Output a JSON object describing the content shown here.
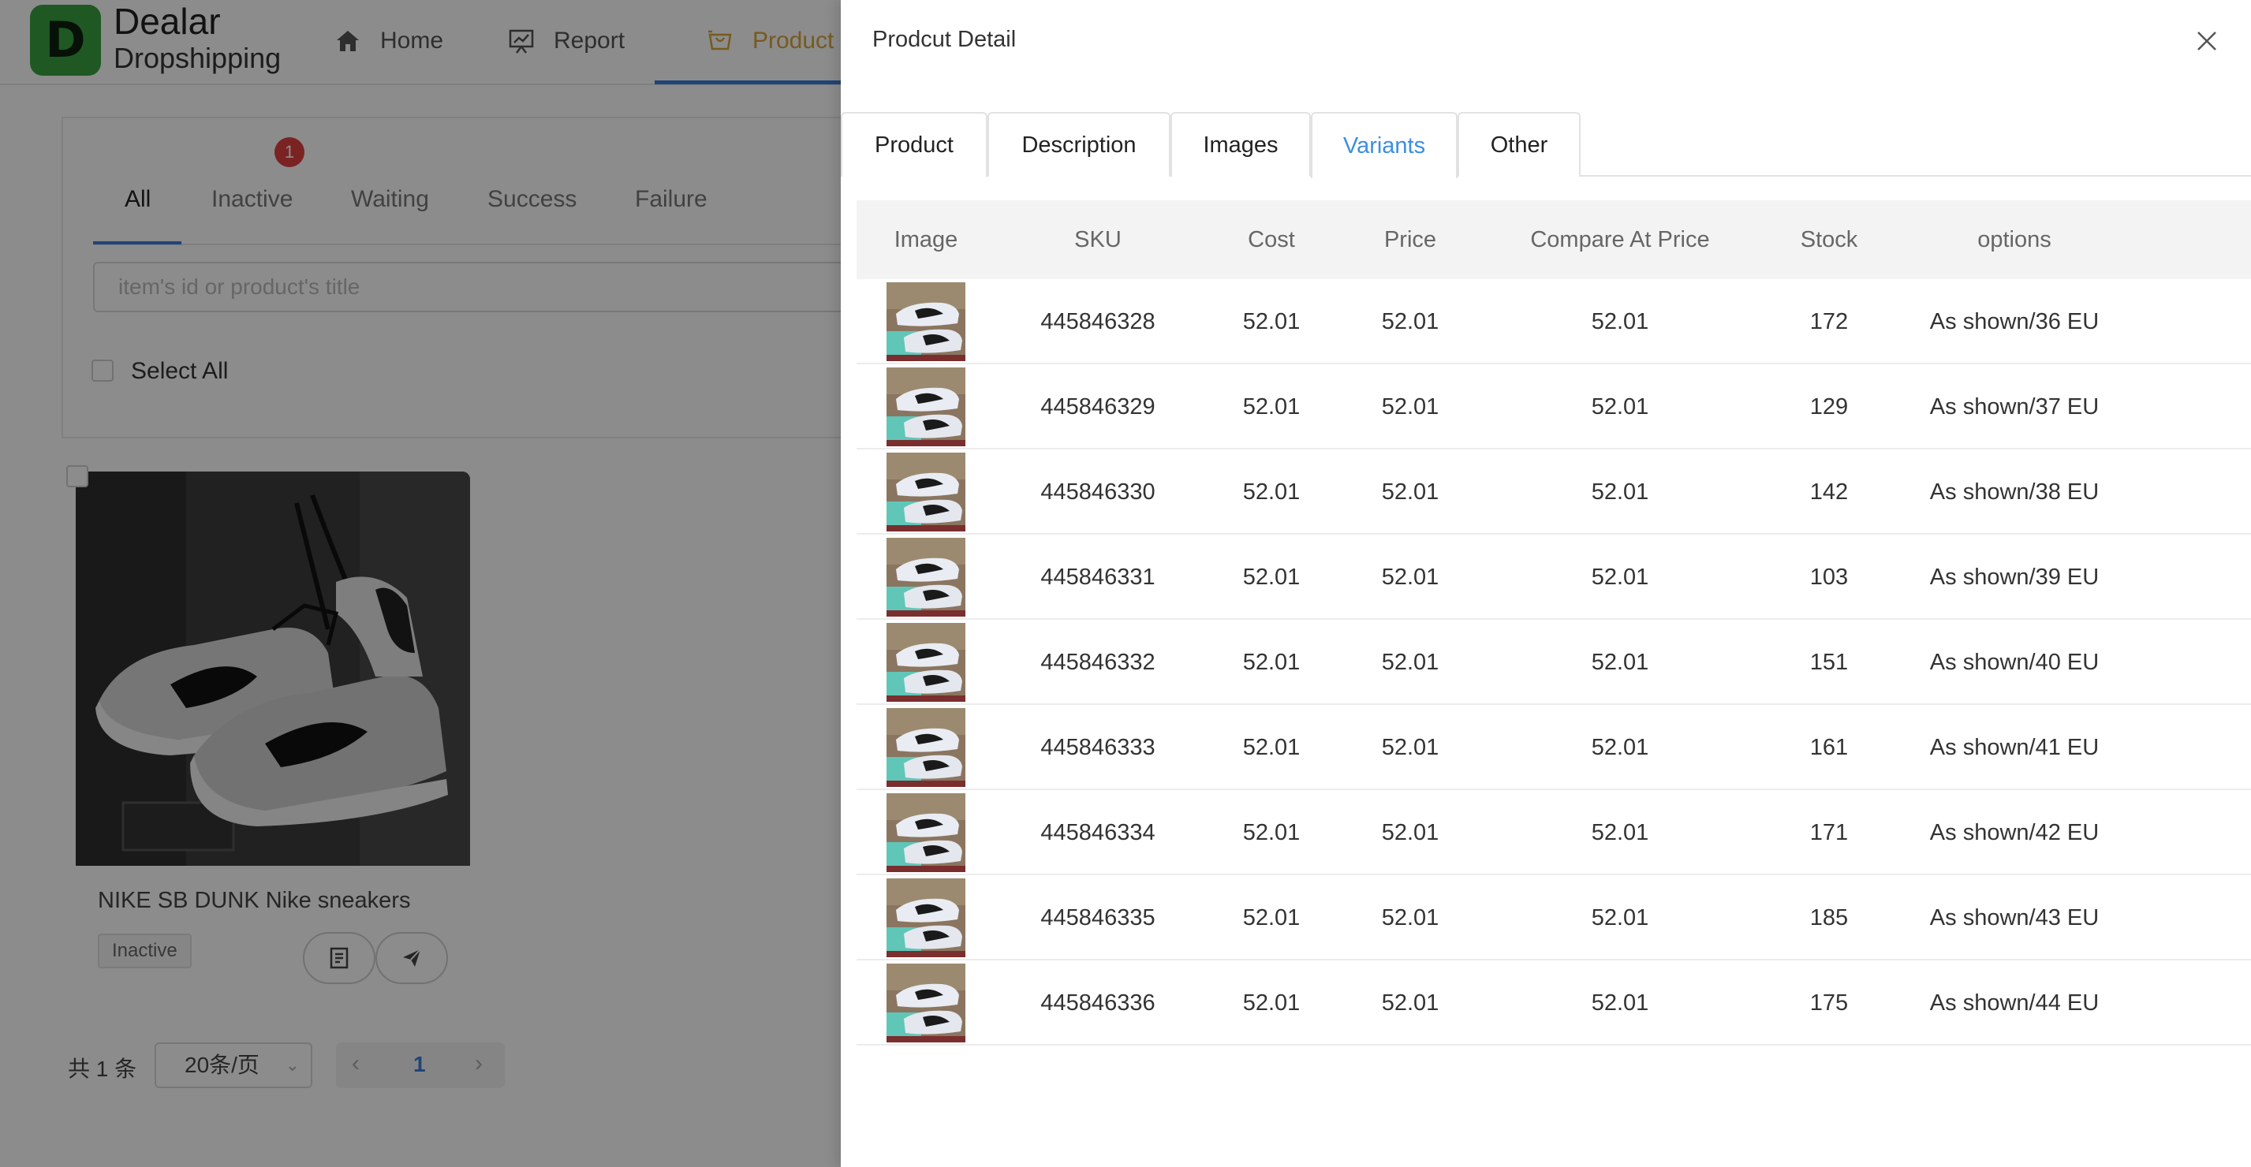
{
  "app": {
    "brand_name": "Dealar",
    "brand_sub": "Dropshipping",
    "logo_letter": "D",
    "accent_color": "#3b7ddd",
    "logo_color": "#3aa141"
  },
  "nav": {
    "home": "Home",
    "report": "Report",
    "product": "Product"
  },
  "filters": {
    "tabs": [
      "All",
      "Inactive",
      "Waiting",
      "Success",
      "Failure"
    ],
    "inactive_badge": "1",
    "search_placeholder": "item's id or product's title",
    "select_all": "Select All"
  },
  "product_card": {
    "title": "NIKE SB DUNK Nike sneakers",
    "status": "Inactive"
  },
  "pagination": {
    "total": "共 1 条",
    "page_size": "20条/页",
    "current_page": "1"
  },
  "drawer": {
    "title": "Prodcut Detail",
    "tabs": [
      "Product",
      "Description",
      "Images",
      "Variants",
      "Other"
    ],
    "active_tab": "Variants",
    "columns": [
      "Image",
      "SKU",
      "Cost",
      "Price",
      "Compare At Price",
      "Stock",
      "options"
    ],
    "variants": [
      {
        "sku": "445846328",
        "cost": "52.01",
        "price": "52.01",
        "compare_at": "52.01",
        "stock": "172",
        "option": "As shown/36 EU"
      },
      {
        "sku": "445846329",
        "cost": "52.01",
        "price": "52.01",
        "compare_at": "52.01",
        "stock": "129",
        "option": "As shown/37 EU"
      },
      {
        "sku": "445846330",
        "cost": "52.01",
        "price": "52.01",
        "compare_at": "52.01",
        "stock": "142",
        "option": "As shown/38 EU"
      },
      {
        "sku": "445846331",
        "cost": "52.01",
        "price": "52.01",
        "compare_at": "52.01",
        "stock": "103",
        "option": "As shown/39 EU"
      },
      {
        "sku": "445846332",
        "cost": "52.01",
        "price": "52.01",
        "compare_at": "52.01",
        "stock": "151",
        "option": "As shown/40 EU"
      },
      {
        "sku": "445846333",
        "cost": "52.01",
        "price": "52.01",
        "compare_at": "52.01",
        "stock": "161",
        "option": "As shown/41 EU"
      },
      {
        "sku": "445846334",
        "cost": "52.01",
        "price": "52.01",
        "compare_at": "52.01",
        "stock": "171",
        "option": "As shown/42 EU"
      },
      {
        "sku": "445846335",
        "cost": "52.01",
        "price": "52.01",
        "compare_at": "52.01",
        "stock": "185",
        "option": "As shown/43 EU"
      },
      {
        "sku": "445846336",
        "cost": "52.01",
        "price": "52.01",
        "compare_at": "52.01",
        "stock": "175",
        "option": "As shown/44 EU"
      }
    ]
  }
}
